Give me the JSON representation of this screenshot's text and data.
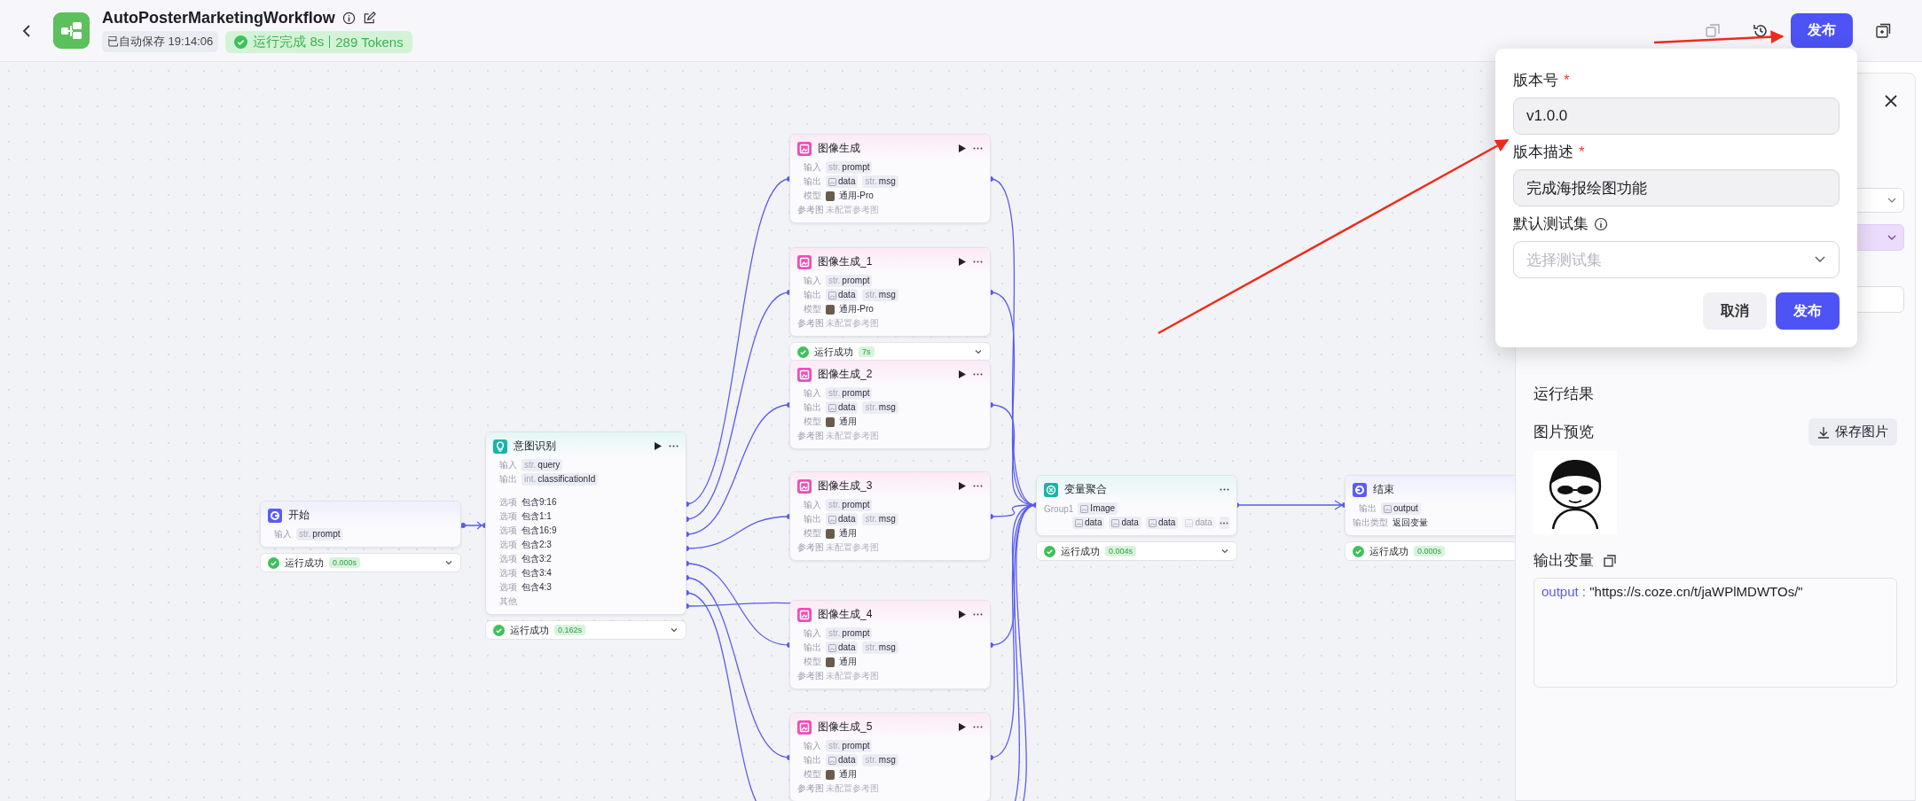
{
  "header": {
    "title": "AutoPosterMarketingWorkflow",
    "autosave": "已自动保存 19:14:06",
    "run_status": "运行完成 8s",
    "tokens": "289 Tokens",
    "publish": "发布"
  },
  "nodes": [
    {
      "kind": "start",
      "title": "开始",
      "rows": [
        {
          "kind": "io",
          "label": "输入",
          "tags": [
            {
              "kind": "str",
              "prefix": "str.",
              "text": "prompt"
            }
          ]
        }
      ],
      "status": {
        "text": "运行成功",
        "time": "0.000s"
      }
    },
    {
      "kind": "intent",
      "title": "意图识别",
      "run_button": true,
      "more_button": true,
      "rows": [
        {
          "kind": "io",
          "label": "输入",
          "tags": [
            {
              "kind": "str",
              "prefix": "str.",
              "text": "query"
            }
          ]
        },
        {
          "kind": "io",
          "label": "输出",
          "tags": [
            {
              "kind": "str",
              "prefix": "int.",
              "text": "classificationId"
            }
          ]
        },
        {
          "kind": "gap"
        },
        {
          "kind": "option",
          "label": "选项",
          "value": "包含9:16"
        },
        {
          "kind": "option",
          "label": "选项",
          "value": "包含1:1"
        },
        {
          "kind": "option",
          "label": "选项",
          "value": "包含16:9"
        },
        {
          "kind": "option",
          "label": "选项",
          "value": "包含2:3"
        },
        {
          "kind": "option",
          "label": "选项",
          "value": "包含3:2"
        },
        {
          "kind": "option",
          "label": "选项",
          "value": "包含3:4"
        },
        {
          "kind": "option",
          "label": "选项",
          "value": "包含4:3"
        },
        {
          "kind": "option",
          "label": "其他"
        }
      ],
      "status": {
        "text": "运行成功",
        "time": "0.162s"
      }
    },
    {
      "kind": "image",
      "title": "图像生成",
      "run_button": true,
      "more_button": true,
      "rows": [
        {
          "kind": "io",
          "label": "输入",
          "tags": [
            {
              "kind": "str",
              "prefix": "str.",
              "text": "prompt"
            }
          ]
        },
        {
          "kind": "io",
          "label": "输出",
          "tags": [
            {
              "kind": "image",
              "text": "data"
            },
            {
              "kind": "str",
              "prefix": "str.",
              "text": "msg"
            }
          ]
        },
        {
          "kind": "model",
          "label": "模型",
          "value": "通用-Pro"
        },
        {
          "kind": "note",
          "label": "参考图",
          "value": "未配置参考图"
        }
      ]
    },
    {
      "kind": "image",
      "title": "图像生成_1",
      "run_button": true,
      "more_button": true,
      "rows": [
        {
          "kind": "io",
          "label": "输入",
          "tags": [
            {
              "kind": "str",
              "prefix": "str.",
              "text": "prompt"
            }
          ]
        },
        {
          "kind": "io",
          "label": "输出",
          "tags": [
            {
              "kind": "image",
              "text": "data"
            },
            {
              "kind": "str",
              "prefix": "str.",
              "text": "msg"
            }
          ]
        },
        {
          "kind": "model",
          "label": "模型",
          "value": "通用-Pro"
        },
        {
          "kind": "note",
          "label": "参考图",
          "value": "未配置参考图"
        }
      ],
      "status": {
        "text": "运行成功",
        "time": "7s"
      }
    },
    {
      "kind": "image",
      "title": "图像生成_2",
      "run_button": true,
      "more_button": true,
      "rows": [
        {
          "kind": "io",
          "label": "输入",
          "tags": [
            {
              "kind": "str",
              "prefix": "str.",
              "text": "prompt"
            }
          ]
        },
        {
          "kind": "io",
          "label": "输出",
          "tags": [
            {
              "kind": "image",
              "text": "data"
            },
            {
              "kind": "str",
              "prefix": "str.",
              "text": "msg"
            }
          ]
        },
        {
          "kind": "model",
          "label": "模型",
          "value": "通用"
        },
        {
          "kind": "note",
          "label": "参考图",
          "value": "未配置参考图"
        }
      ]
    },
    {
      "kind": "image",
      "title": "图像生成_3",
      "run_button": true,
      "more_button": true,
      "rows": [
        {
          "kind": "io",
          "label": "输入",
          "tags": [
            {
              "kind": "str",
              "prefix": "str.",
              "text": "prompt"
            }
          ]
        },
        {
          "kind": "io",
          "label": "输出",
          "tags": [
            {
              "kind": "image",
              "text": "data"
            },
            {
              "kind": "str",
              "prefix": "str.",
              "text": "msg"
            }
          ]
        },
        {
          "kind": "model",
          "label": "模型",
          "value": "通用"
        },
        {
          "kind": "note",
          "label": "参考图",
          "value": "未配置参考图"
        }
      ]
    },
    {
      "kind": "image",
      "title": "图像生成_4",
      "run_button": true,
      "more_button": true,
      "rows": [
        {
          "kind": "io",
          "label": "输入",
          "tags": [
            {
              "kind": "str",
              "prefix": "str.",
              "text": "prompt"
            }
          ]
        },
        {
          "kind": "io",
          "label": "输出",
          "tags": [
            {
              "kind": "image",
              "text": "data"
            },
            {
              "kind": "str",
              "prefix": "str.",
              "text": "msg"
            }
          ]
        },
        {
          "kind": "model",
          "label": "模型",
          "value": "通用"
        },
        {
          "kind": "note",
          "label": "参考图",
          "value": "未配置参考图"
        }
      ]
    },
    {
      "kind": "image",
      "title": "图像生成_5",
      "run_button": true,
      "more_button": true,
      "rows": [
        {
          "kind": "io",
          "label": "输入",
          "tags": [
            {
              "kind": "str",
              "prefix": "str.",
              "text": "prompt"
            }
          ]
        },
        {
          "kind": "io",
          "label": "输出",
          "tags": [
            {
              "kind": "image",
              "text": "data"
            },
            {
              "kind": "str",
              "prefix": "str.",
              "text": "msg"
            }
          ]
        },
        {
          "kind": "model",
          "label": "模型",
          "value": "通用"
        },
        {
          "kind": "note",
          "label": "参考图",
          "value": "未配置参考图"
        }
      ]
    },
    {
      "kind": "aggregate",
      "title": "变量聚合",
      "more_button": true,
      "rows": [
        {
          "kind": "io",
          "label": "Group1",
          "tags": [
            {
              "kind": "image",
              "text": "Image"
            }
          ]
        },
        {
          "kind": "io",
          "more": true,
          "tags": [
            {
              "kind": "image",
              "text": "data"
            },
            {
              "kind": "image",
              "text": "data"
            },
            {
              "kind": "image",
              "text": "data"
            },
            {
              "kind": "image",
              "text": "data",
              "faded": true
            }
          ]
        }
      ],
      "status": {
        "text": "运行成功",
        "time": "0.004s"
      }
    },
    {
      "kind": "end",
      "title": "结束",
      "rows": [
        {
          "kind": "io",
          "label": "输出",
          "tags": [
            {
              "kind": "image",
              "text": "output"
            }
          ]
        },
        {
          "kind": "option",
          "label": "输出类型",
          "value": "返回变量"
        }
      ],
      "status": {
        "text": "运行成功",
        "time": "0.000s"
      }
    }
  ],
  "panel": {
    "results_title": "运行结果",
    "preview_title": "图片预览",
    "save_button": "保存图片",
    "output_title": "输出变量",
    "output_key": "output :",
    "output_value": "\"https://s.coze.cn/t/jaWPlMDWTOs/\""
  },
  "popover": {
    "fields": [
      {
        "kind": "input",
        "label": "版本号",
        "required_mark": "*",
        "value": "v1.0.0"
      },
      {
        "kind": "input",
        "label": "版本描述",
        "required_mark": "*",
        "value": "完成海报绘图功能"
      },
      {
        "kind": "select",
        "label": "默认测试集",
        "hint_icon": true,
        "placeholder": "选择测试集"
      }
    ],
    "buttons": [
      {
        "kind": "secondary",
        "label": "取消"
      },
      {
        "kind": "primary",
        "label": "发布"
      }
    ]
  }
}
